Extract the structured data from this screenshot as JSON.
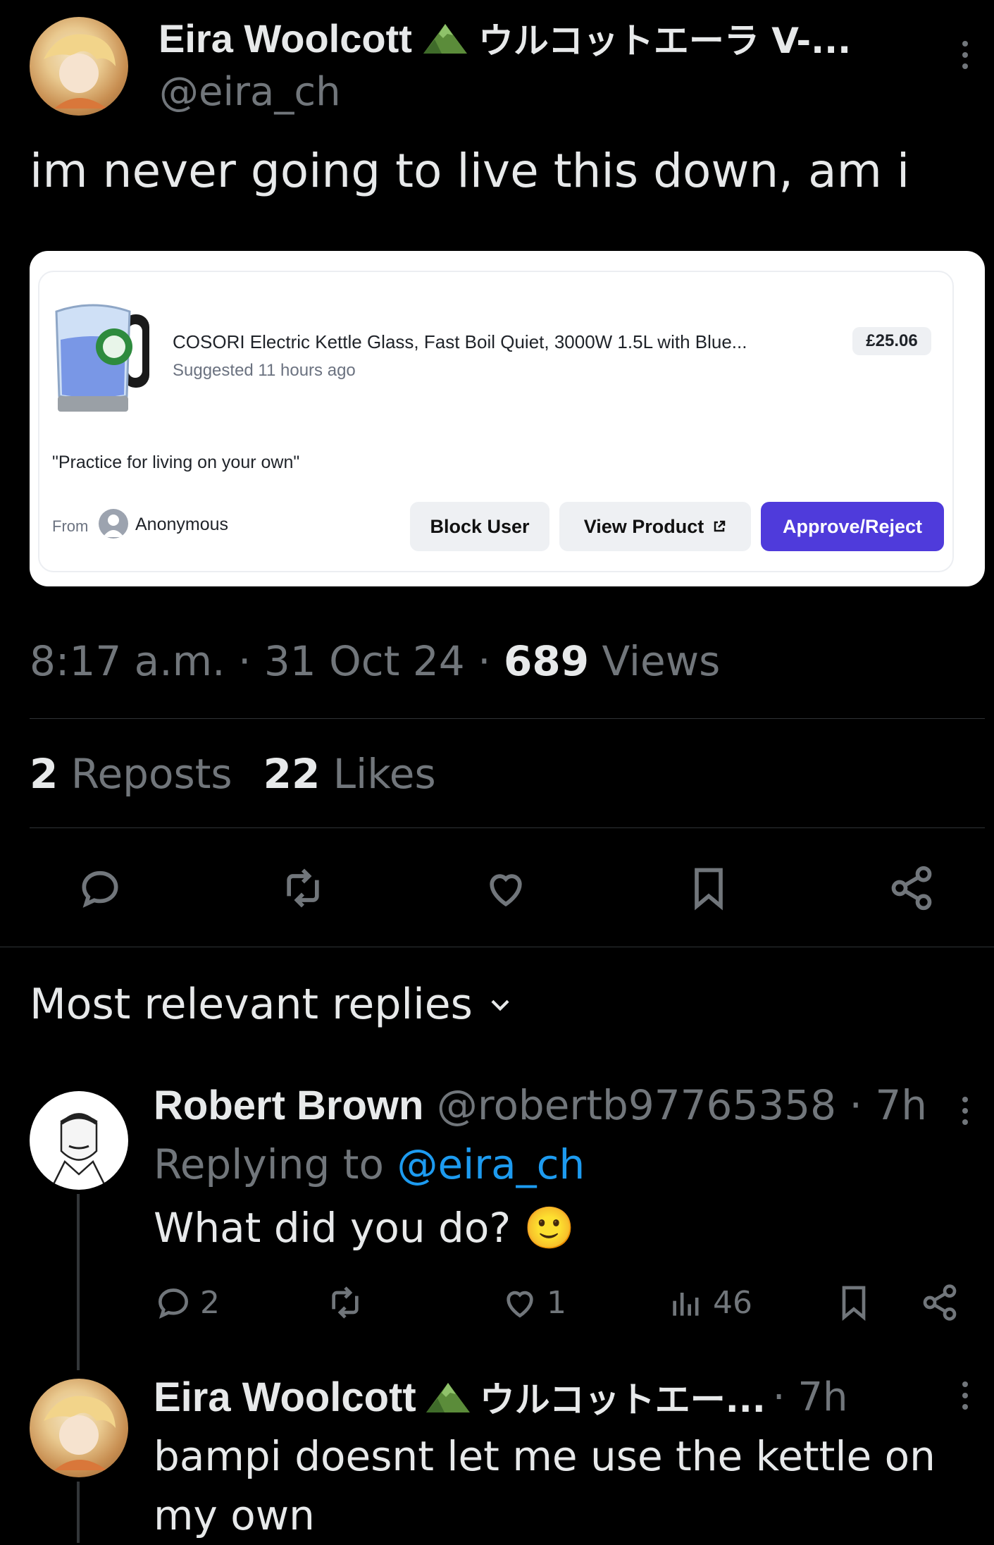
{
  "tweet": {
    "author_name": "Eira Woolcott",
    "author_suffix": "ウルコットエーラ V-...",
    "handle": "@eira_ch",
    "text": "im never going to live this down, am i",
    "timestamp": "8:17 a.m. · 31 Oct 24 · ",
    "views_count": "689",
    "views_label": " Views",
    "reposts_count": "2",
    "reposts_label": " Reposts",
    "likes_count": "22",
    "likes_label": " Likes"
  },
  "embed": {
    "product_title": "COSORI Electric Kettle Glass, Fast Boil Quiet, 3000W 1.5L with Blue...",
    "suggested": "Suggested 11 hours ago",
    "price": "£25.06",
    "quote": "\"Practice for living on your own\"",
    "from_label": "From",
    "from_user": "Anonymous",
    "block_user": "Block User",
    "view_product": "View Product",
    "approve_reject": "Approve/Reject",
    "colors": {
      "primary": "#4f3bdb"
    }
  },
  "actions": [
    "reply-icon",
    "repost-icon",
    "like-icon",
    "bookmark-icon",
    "share-icon"
  ],
  "replies_header": "Most relevant replies",
  "replies": [
    {
      "name": "Robert Brown",
      "handle_time": "@robertb97765358 · 7h",
      "replying_prefix": "Replying to ",
      "replying_handle": "@eira_ch",
      "text": "What did you do? 🙂",
      "reply_count": "2",
      "like_count": "1",
      "view_count": "46"
    },
    {
      "name": "Eira Woolcott",
      "name_suffix": "ウルコットエー...",
      "time": "· 7h",
      "text": "bampi doesnt let me use the kettle on my own"
    }
  ],
  "colors": {
    "background": "#000000",
    "text": "#e7e9ea",
    "muted": "#71767b",
    "link": "#1d9bf0"
  }
}
